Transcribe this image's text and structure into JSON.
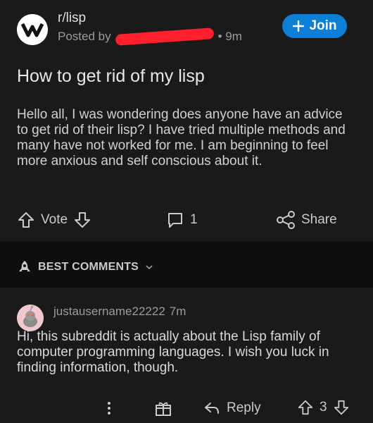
{
  "post": {
    "subreddit": "r/lisp",
    "posted_by_prefix": "Posted by",
    "time": "• 9m",
    "join_label": "Join",
    "title": "How to get rid of my lisp",
    "body": "Hello all, I was wondering does anyone have an advice to get rid of their lisp? I have tried multiple methods and many have not worked for me. I am beginning to feel more anxious and self conscious about it.",
    "vote_label": "Vote",
    "comment_count": "1",
    "share_label": "Share"
  },
  "comments_header": {
    "sort_label": "BEST COMMENTS"
  },
  "comment": {
    "username": "justausername22222",
    "time": "7m",
    "text": "Hi, this subreddit is actually about the Lisp family of computer programming languages. I wish you luck in finding information, though.",
    "reply_label": "Reply",
    "score": "3"
  },
  "colors": {
    "background": "#1a1a1b",
    "join_button": "#0d7fd6",
    "redaction": "#ff1f2d"
  }
}
